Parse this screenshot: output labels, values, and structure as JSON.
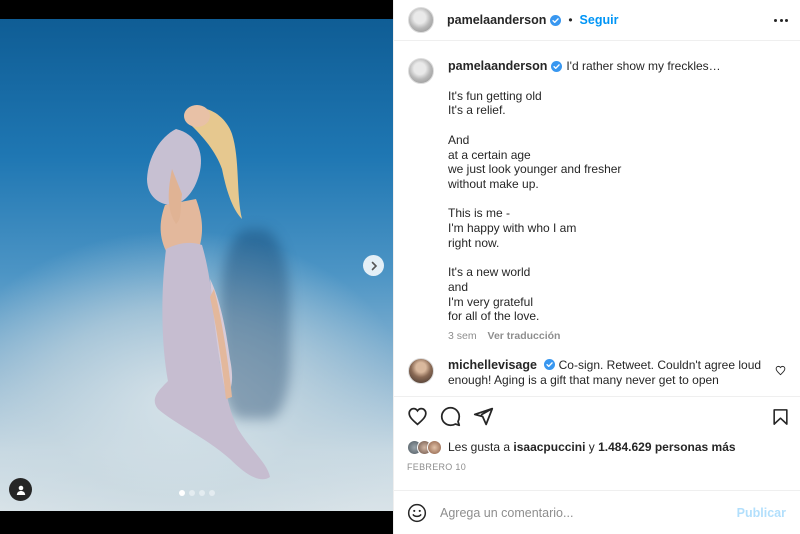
{
  "post": {
    "username": "pamelaanderson",
    "follow_label": "Seguir",
    "separator": "•",
    "carousel": {
      "total": 4,
      "active": 0
    }
  },
  "caption": {
    "username": "pamelaanderson",
    "first_line": "I'd rather show my freckles…",
    "lines": [
      "It's fun getting old",
      "It's a relief.",
      "",
      "And",
      "at a certain age",
      "we just look younger and fresher",
      "without make up.",
      "",
      "This is me -",
      "I'm happy with who I am",
      "right now.",
      "",
      "It's a new world",
      "and",
      "I'm very grateful",
      "for all of the love."
    ],
    "time": "3 sem",
    "translate_label": "Ver traducción"
  },
  "comment": {
    "username": "michellevisage",
    "text": "Co-sign. Retweet. Couldn't agree loud enough! Aging is a gift that many never get to open"
  },
  "likes": {
    "prefix": "Les gusta a",
    "user": "isaacpuccini",
    "connector": "y",
    "count_text": "1.484.629 personas más"
  },
  "date": "FEBRERO 10",
  "add_comment": {
    "placeholder": "Agrega un comentario...",
    "publish_label": "Publicar"
  },
  "colors": {
    "accent": "#0095f6",
    "verified": "#3897f0",
    "publish_disabled": "#b2dffc",
    "muted": "#8e8e8e"
  }
}
